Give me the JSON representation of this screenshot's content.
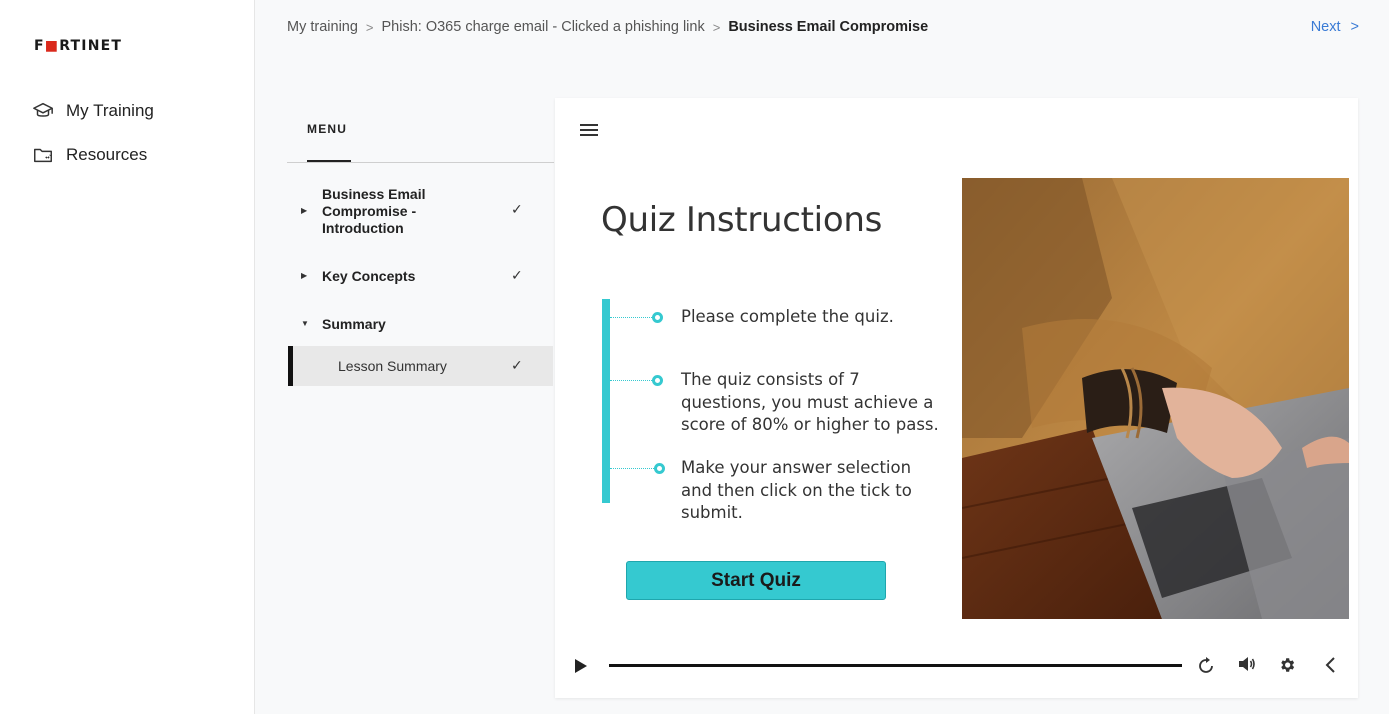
{
  "app": {
    "brand": "FORTINET"
  },
  "sidebar": {
    "items": [
      {
        "label": "My Training",
        "icon": "graduation-cap-icon"
      },
      {
        "label": "Resources",
        "icon": "folder-icon"
      }
    ]
  },
  "breadcrumb": {
    "items": [
      "My training",
      "Phish: O365 charge email - Clicked a phishing link"
    ],
    "current": "Business Email Compromise",
    "separator": ">"
  },
  "header": {
    "next_label": "Next",
    "next_arrow": ">"
  },
  "menu": {
    "tab_label": "MENU",
    "items": [
      {
        "label": "Business Email Compromise - Introduction",
        "completed": true,
        "expanded": false
      },
      {
        "label": "Key Concepts",
        "completed": true,
        "expanded": false
      },
      {
        "label": "Summary",
        "completed": false,
        "expanded": true
      }
    ],
    "sub_items": [
      {
        "label": "Lesson Summary",
        "completed": true,
        "active": true
      }
    ],
    "check_glyph": "✓"
  },
  "slide": {
    "title": "Quiz Instructions",
    "bullets": [
      "Please complete the quiz.",
      "The quiz consists of 7 questions, you must achieve a score of 80% or higher to pass.",
      "Make your answer selection and then click on the tick to submit."
    ],
    "start_button": "Start Quiz",
    "accent_color": "#35c9d0"
  },
  "player": {
    "progress": 1.0,
    "controls": [
      "play-icon",
      "replay-icon",
      "volume-icon",
      "settings-icon",
      "collapse-icon"
    ]
  }
}
